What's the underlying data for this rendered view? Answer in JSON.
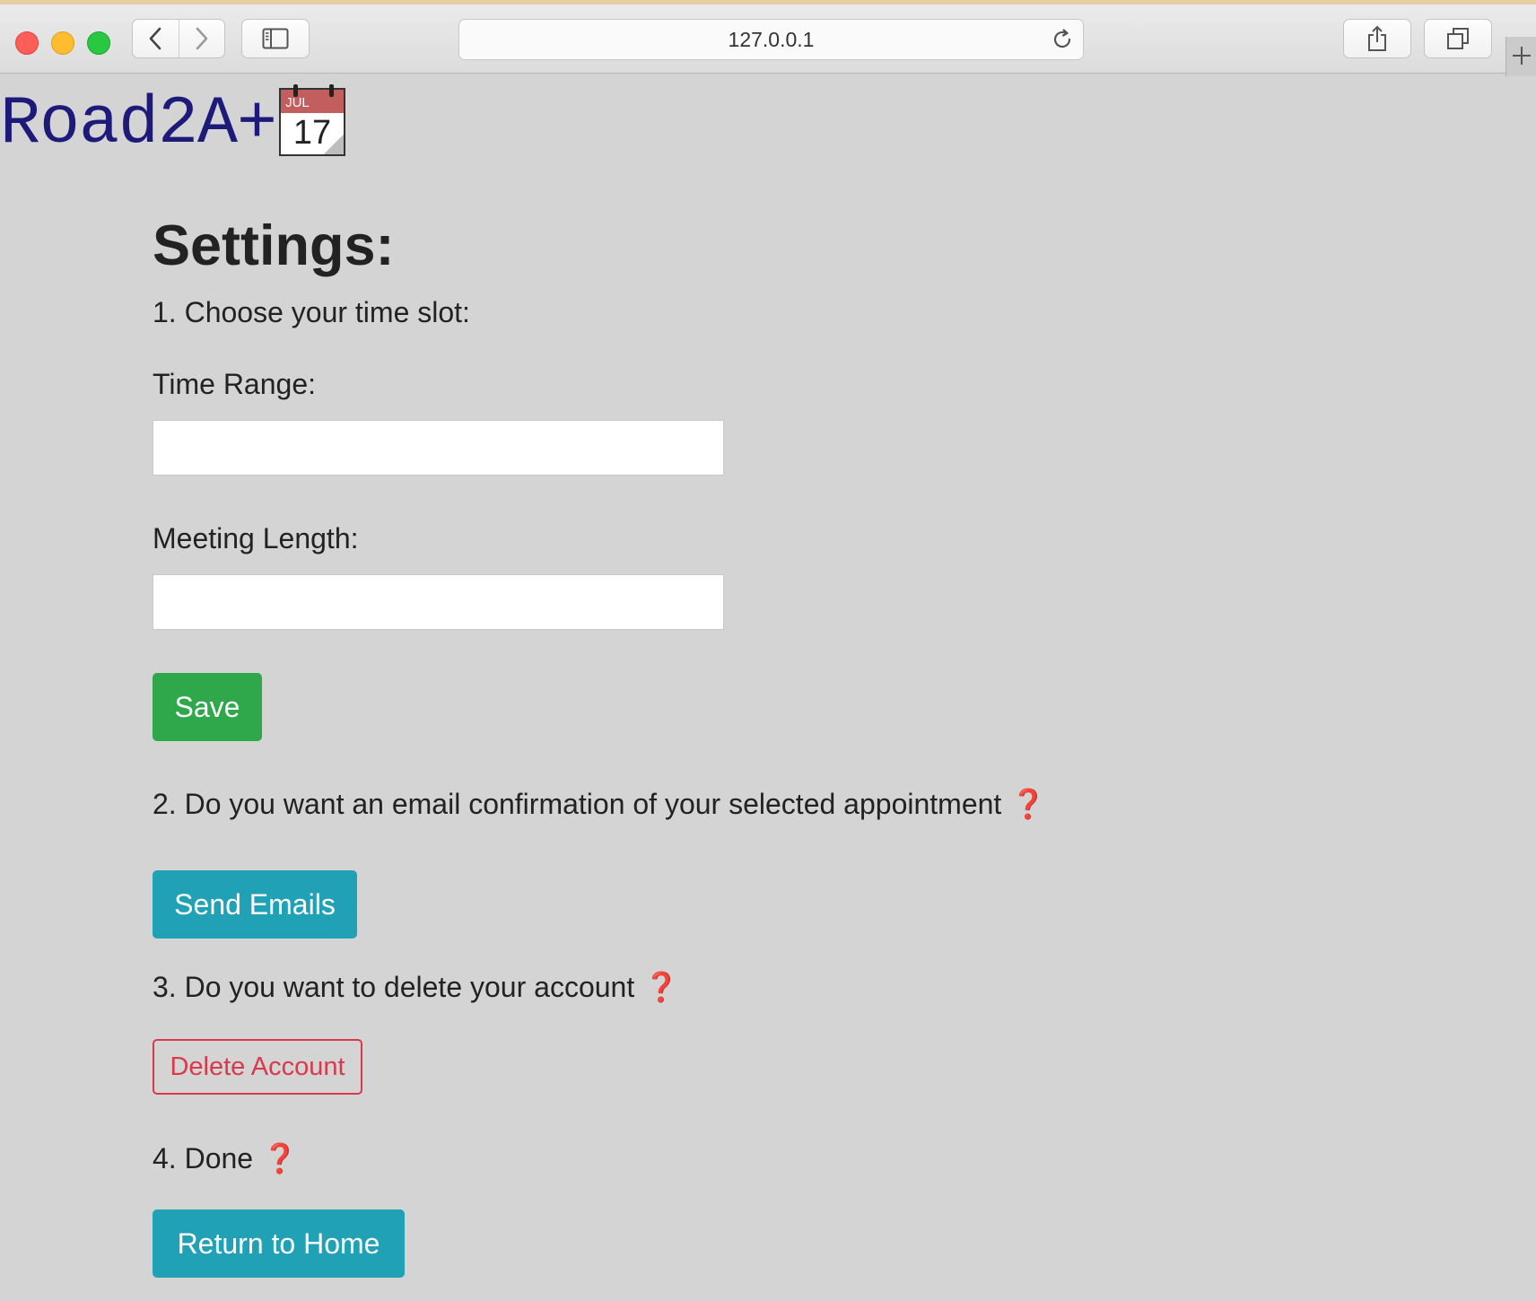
{
  "browser": {
    "url": "127.0.0.1",
    "buttons": {
      "back": "back",
      "forward": "forward",
      "sidebar": "sidebar",
      "share": "share",
      "tabs": "tabs",
      "new_tab": "new-tab"
    }
  },
  "brand": {
    "name": "Road2A+",
    "calendar_month": "JUL",
    "calendar_day": "17"
  },
  "page": {
    "title": "Settings:",
    "step1": "1. Choose your time slot:",
    "time_range_label": "Time Range:",
    "time_range_value": "",
    "meeting_length_label": "Meeting Length:",
    "meeting_length_value": "",
    "save_label": "Save",
    "step2": "2. Do you want an email confirmation of your selected appointment",
    "send_emails_label": "Send Emails",
    "step3": "3. Do you want to delete your account",
    "delete_account_label": "Delete Account",
    "step4": "4. Done",
    "return_home_label": "Return to Home",
    "question_mark": "❓"
  },
  "colors": {
    "brand_text": "#1d1a7a",
    "save_button": "#2ea84a",
    "info_button": "#20a1b6",
    "danger": "#d83a4c",
    "question_mark": "#d2152b",
    "page_background": "#d4d4d4"
  }
}
